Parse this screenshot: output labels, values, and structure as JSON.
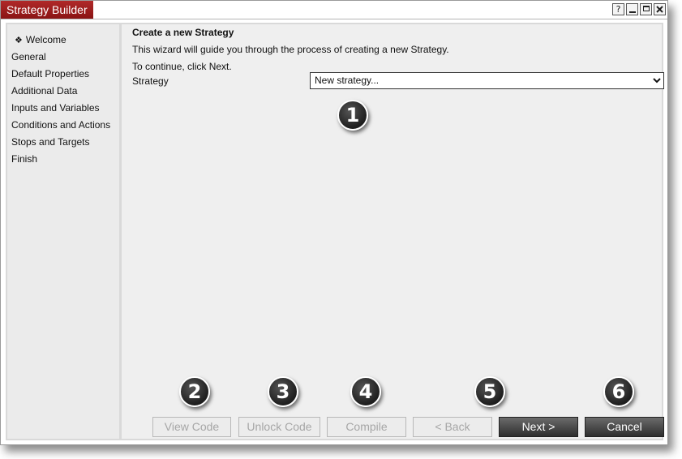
{
  "window": {
    "title": "Strategy Builder",
    "controls": {
      "help": "?"
    }
  },
  "sidebar": {
    "items": [
      {
        "label": "Welcome",
        "active": true,
        "bullet": "❖"
      },
      {
        "label": "General"
      },
      {
        "label": "Default Properties"
      },
      {
        "label": "Additional Data"
      },
      {
        "label": "Inputs and Variables"
      },
      {
        "label": "Conditions and Actions"
      },
      {
        "label": "Stops and Targets"
      },
      {
        "label": "Finish"
      }
    ]
  },
  "main": {
    "heading": "Create a new Strategy",
    "description": "This wizard will guide you through the process of creating a new Strategy.",
    "continue_text": "To continue, click Next.",
    "strategy_label": "Strategy",
    "strategy_value": "New strategy..."
  },
  "callouts": [
    "1",
    "2",
    "3",
    "4",
    "5",
    "6"
  ],
  "buttons": {
    "view_code": "View Code",
    "unlock_code": "Unlock Code",
    "compile": "Compile",
    "back": "< Back",
    "next": "Next >",
    "cancel": "Cancel"
  },
  "colors": {
    "title_bg": "#9b1f1f",
    "primary_button": "#3a3a3a",
    "callout": "#222222"
  }
}
